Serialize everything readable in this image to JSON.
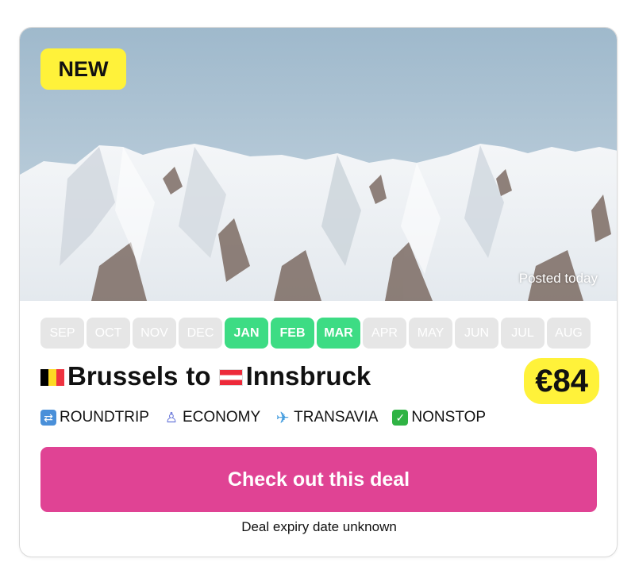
{
  "badge": {
    "label": "NEW"
  },
  "hero": {
    "posted_label": "Posted today"
  },
  "months": [
    {
      "label": "SEP",
      "active": false
    },
    {
      "label": "OCT",
      "active": false
    },
    {
      "label": "NOV",
      "active": false
    },
    {
      "label": "DEC",
      "active": false
    },
    {
      "label": "JAN",
      "active": true
    },
    {
      "label": "FEB",
      "active": true
    },
    {
      "label": "MAR",
      "active": true
    },
    {
      "label": "APR",
      "active": false
    },
    {
      "label": "MAY",
      "active": false
    },
    {
      "label": "JUN",
      "active": false
    },
    {
      "label": "JUL",
      "active": false
    },
    {
      "label": "AUG",
      "active": false
    }
  ],
  "route": {
    "origin": "Brussels",
    "separator": "to",
    "destination": "Innsbruck",
    "origin_flag": "flag-belgium",
    "destination_flag": "flag-austria"
  },
  "price": "€84",
  "features": [
    {
      "icon": "roundtrip-icon",
      "label": "ROUNDTRIP"
    },
    {
      "icon": "seat-icon",
      "label": "ECONOMY"
    },
    {
      "icon": "airplane-icon",
      "label": "TRANSAVIA"
    },
    {
      "icon": "checkmark-icon",
      "label": "NONSTOP"
    }
  ],
  "cta": {
    "label": "Check out this deal"
  },
  "expiry": "Deal expiry date unknown",
  "colors": {
    "accent_pink": "#e04394",
    "badge_yellow": "#fff23a",
    "month_active_green": "#3ddc84",
    "month_inactive_gray": "#e6e6e6"
  }
}
